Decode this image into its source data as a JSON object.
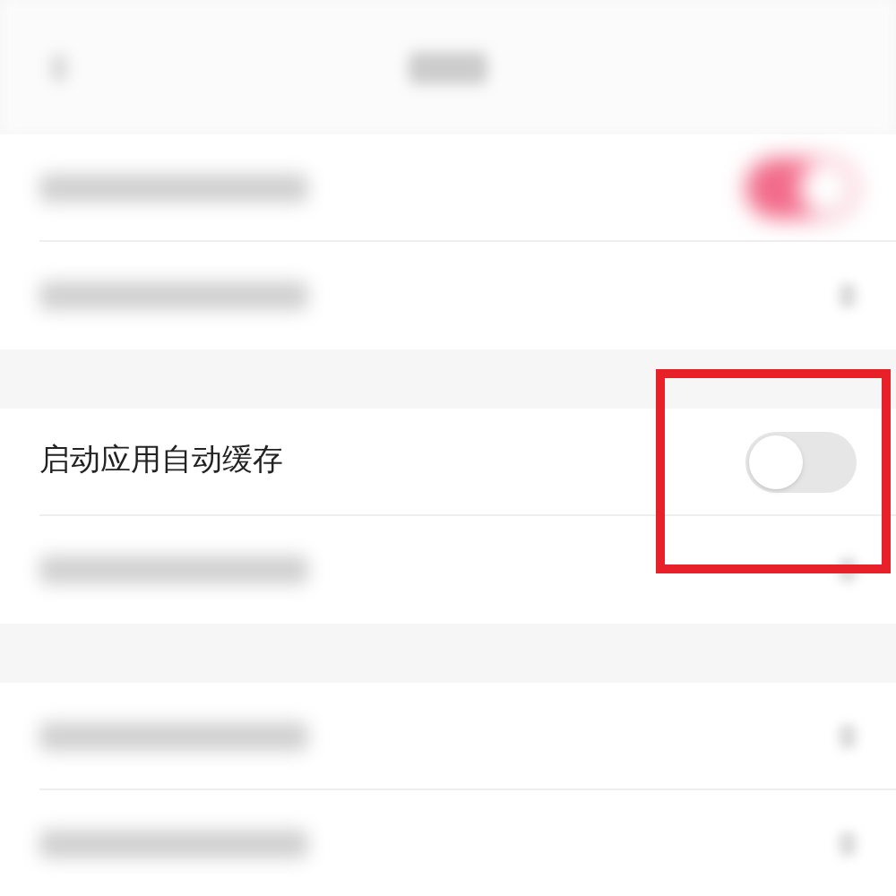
{
  "nav_bar": {
    "blurred": true
  },
  "sections": [
    {
      "rows": [
        {
          "kind": "toggle",
          "blurred": true,
          "on": true
        },
        {
          "kind": "link",
          "blurred": true
        }
      ]
    },
    {
      "rows": [
        {
          "kind": "toggle",
          "blurred": false,
          "label": "启动应用自动缓存",
          "on": false
        },
        {
          "kind": "link",
          "blurred": true
        }
      ]
    },
    {
      "rows": [
        {
          "kind": "link",
          "blurred": true
        },
        {
          "kind": "link",
          "blurred": true
        }
      ]
    }
  ],
  "highlight": {
    "shown": true
  }
}
